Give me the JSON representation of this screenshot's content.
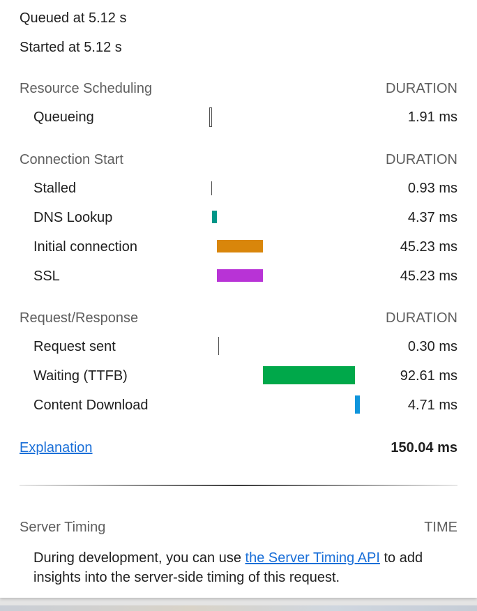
{
  "summary": {
    "queued": "Queued at 5.12 s",
    "started": "Started at 5.12 s"
  },
  "sections": {
    "scheduling": {
      "title": "Resource Scheduling",
      "column": "DURATION",
      "rows": [
        {
          "label": "Queueing",
          "value": "1.91 ms",
          "bar_color": "#ffffff",
          "bar_border": "#555555"
        }
      ]
    },
    "connection": {
      "title": "Connection Start",
      "column": "DURATION",
      "rows": [
        {
          "label": "Stalled",
          "value": "0.93 ms",
          "bar_color": "#555555"
        },
        {
          "label": "DNS Lookup",
          "value": "4.37 ms",
          "bar_color": "#009688"
        },
        {
          "label": "Initial connection",
          "value": "45.23 ms",
          "bar_color": "#d9860b"
        },
        {
          "label": "SSL",
          "value": "45.23 ms",
          "bar_color": "#b833d6"
        }
      ]
    },
    "request": {
      "title": "Request/Response",
      "column": "DURATION",
      "rows": [
        {
          "label": "Request sent",
          "value": "0.30 ms",
          "bar_color": "#555555"
        },
        {
          "label": "Waiting (TTFB)",
          "value": "92.61 ms",
          "bar_color": "#00a84a"
        },
        {
          "label": "Content Download",
          "value": "4.71 ms",
          "bar_color": "#0f95dc"
        }
      ]
    }
  },
  "footer": {
    "explanation_link": "Explanation",
    "total": "150.04 ms"
  },
  "server_timing": {
    "title": "Server Timing",
    "column": "TIME",
    "text_before": "During development, you can use ",
    "link": "the Server Timing API",
    "text_after": " to add insights into the server-side timing of this request."
  }
}
